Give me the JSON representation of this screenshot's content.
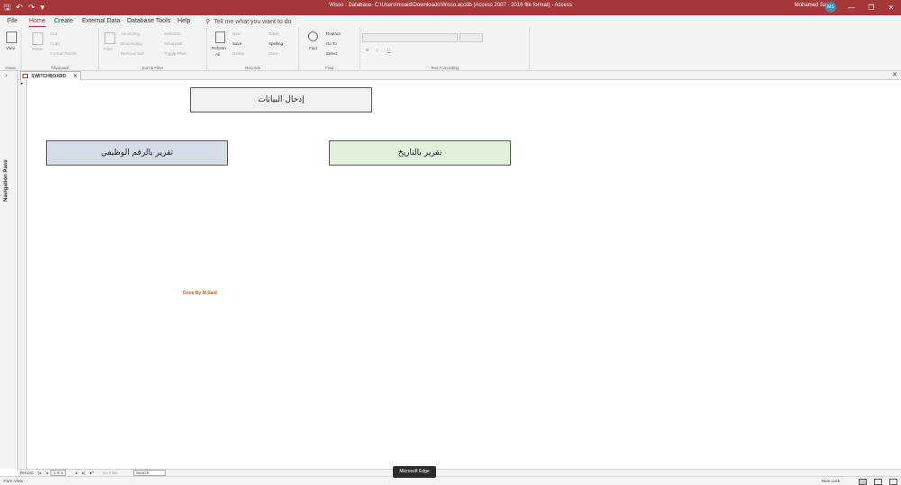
{
  "titlebar": {
    "title": "Wisso : Database- C:\\Users\\msaid\\Downloads\\Wisso.accdb (Access 2007 - 2016 file format) - Access",
    "user": "Mohamed Said",
    "initials": "MS",
    "qat_save": "🖫",
    "qat_undo": "↶",
    "qat_redo": "↷",
    "qat_dropdown": "▾",
    "minimize": "—",
    "restore": "❐",
    "close": "✕"
  },
  "menu": {
    "file": "File",
    "home": "Home",
    "create": "Create",
    "external": "External Data",
    "dbtools": "Database Tools",
    "help": "Help",
    "tellme": "Tell me what you want to do"
  },
  "ribbon": {
    "views": {
      "view": "View",
      "label": "Views"
    },
    "clipboard": {
      "paste": "Paste",
      "cut": "Cut",
      "copy": "Copy",
      "format_painter": "Format Painter",
      "label": "Clipboard"
    },
    "sort_filter": {
      "filter": "Filter",
      "ascending": "Ascending",
      "descending": "Descending",
      "remove_sort": "Remove Sort",
      "selection": "Selection",
      "advanced": "Advanced",
      "toggle_filter": "Toggle Filter",
      "label": "Sort & Filter"
    },
    "records": {
      "refresh": "Refresh",
      "all": "All",
      "new": "New",
      "save": "Save",
      "delete": "Delete",
      "totals": "Totals",
      "spelling": "Spelling",
      "more": "More",
      "label": "Records"
    },
    "find": {
      "find": "Find",
      "replace": "Replace",
      "goto": "Go To",
      "select": "Select",
      "label": "Find"
    },
    "text_formatting": {
      "bold": "B",
      "italic": "I",
      "underline": "U",
      "label": "Text Formatting"
    }
  },
  "nav": {
    "label": "Navigation Pane"
  },
  "doc_tab": {
    "label": "SWITCHBOARD"
  },
  "form": {
    "btn_data_entry": "إدخال البيانات",
    "btn_emp_report": "تقرير بالرقم الوظيفي",
    "btn_date_report": "تقرير بالتاريخ",
    "credit": "Done By M.Said"
  },
  "record_nav": {
    "record": "Record:",
    "position": "1 of 1",
    "no_filter": "No Filter",
    "search": "Search"
  },
  "status": {
    "view": "Form View",
    "numlock": "Num Lock"
  },
  "tooltip": "Microsoft Edge"
}
